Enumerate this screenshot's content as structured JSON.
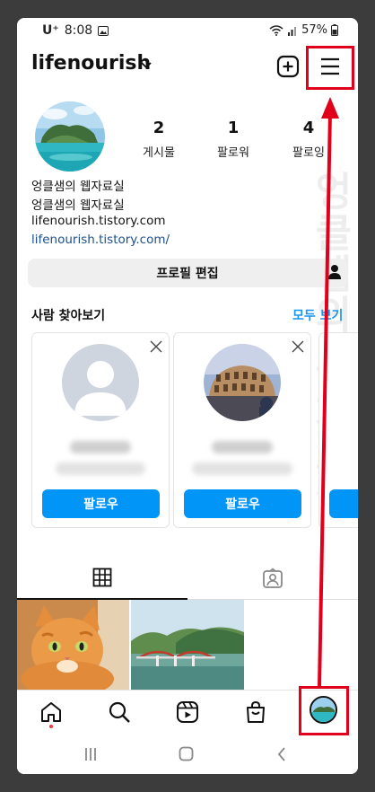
{
  "status": {
    "carrier": "U⁺",
    "time": "8:08",
    "battery": "57%"
  },
  "header": {
    "username": "lifenourish"
  },
  "stats": [
    {
      "count": "2",
      "label": "게시물"
    },
    {
      "count": "1",
      "label": "팔로워"
    },
    {
      "count": "4",
      "label": "팔로잉"
    }
  ],
  "bio": {
    "name": "엉클샘의 웹자료실",
    "line": "엉클샘의 웹자료실",
    "website": "lifenourish.tistory.com",
    "link": "lifenourish.tistory.com/"
  },
  "edit_profile_label": "프로필 편집",
  "discover": {
    "title": "사람 찾아보기",
    "see_all": "모두 보기",
    "cards": [
      {
        "follow_label": "팔로우"
      },
      {
        "follow_label": "팔로우"
      }
    ]
  },
  "watermark": "엉클샘의 웹자료실",
  "colors": {
    "accent": "#0095f6",
    "highlight": "#e0001b",
    "link": "#1c4f8a"
  },
  "icons": [
    "add-post-icon",
    "menu-icon",
    "grid-icon",
    "tagged-icon",
    "home-icon",
    "search-icon",
    "reels-icon",
    "shop-icon"
  ]
}
